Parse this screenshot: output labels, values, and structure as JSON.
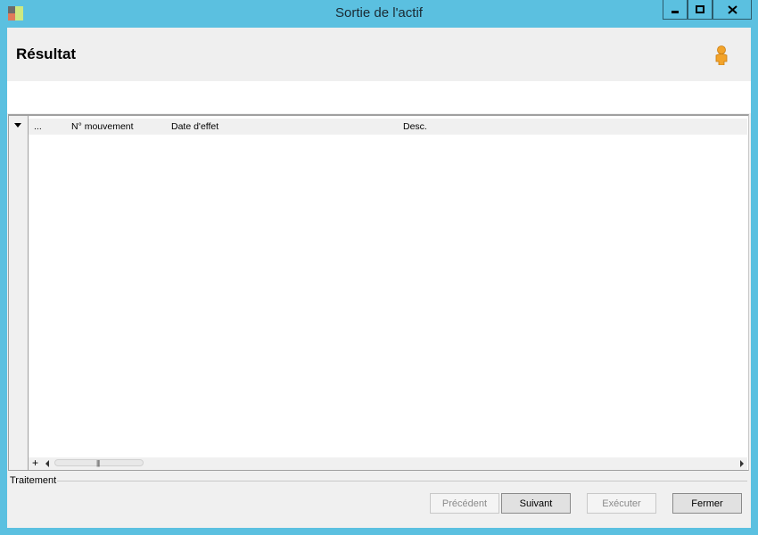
{
  "window": {
    "title": "Sortie de l'actif"
  },
  "header": {
    "title": "Résultat"
  },
  "grid": {
    "columns": [
      "...",
      "N° mouvement",
      "Date d'effet",
      "Desc."
    ],
    "rows": [],
    "footer_add": "+"
  },
  "section": {
    "label": "Traitement"
  },
  "buttons": {
    "previous": "Précédent",
    "next": "Suivant",
    "execute": "Exécuter",
    "close": "Fermer"
  },
  "colors": {
    "titlebar": "#5bc0e0",
    "client_bg": "#f0f0f0"
  }
}
